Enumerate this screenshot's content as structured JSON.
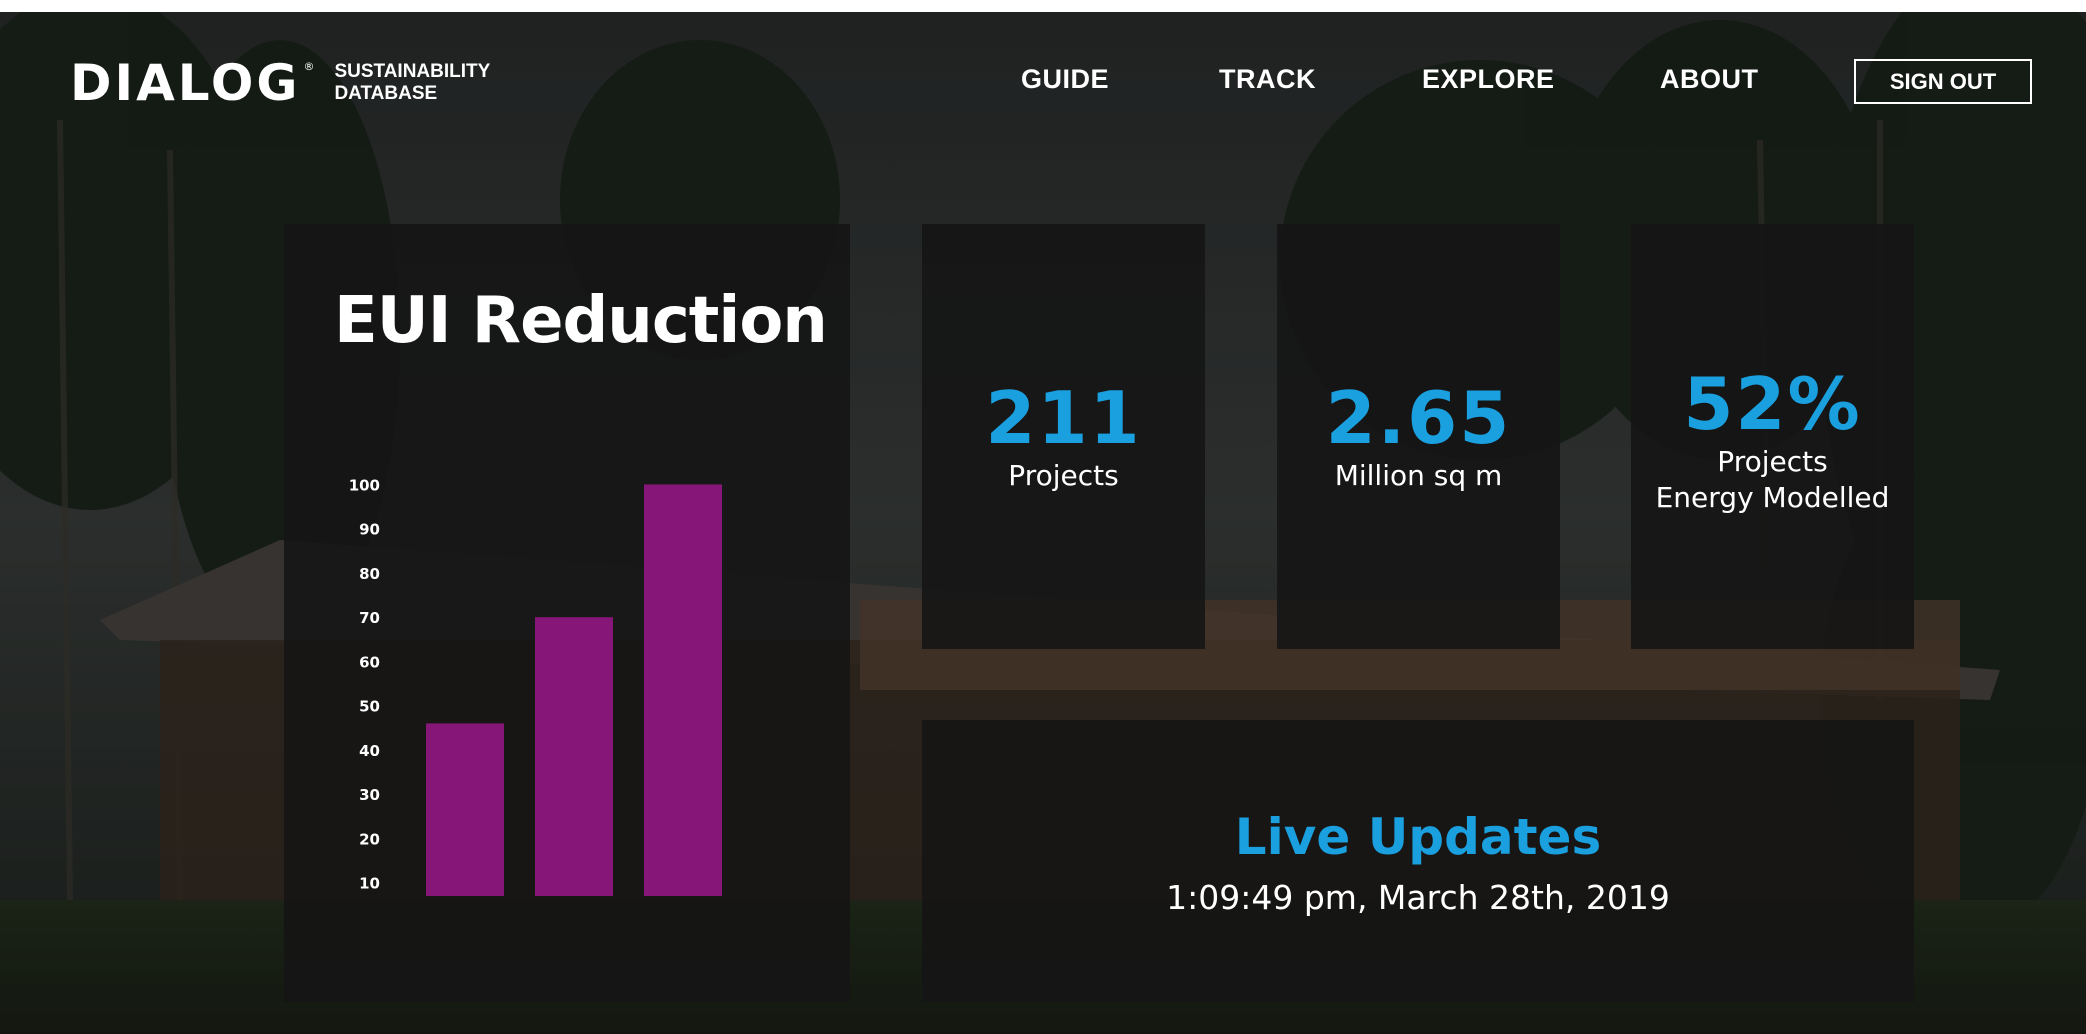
{
  "header": {
    "logo_text": "DIALOG",
    "logo_mark": "®",
    "logo_sub_line1": "SUSTAINABILITY",
    "logo_sub_line2": "DATABASE"
  },
  "nav": {
    "items": [
      {
        "label": "GUIDE"
      },
      {
        "label": "TRACK"
      },
      {
        "label": "EXPLORE"
      },
      {
        "label": "ABOUT"
      }
    ],
    "sign_out_label": "SIGN OUT"
  },
  "stats": {
    "projects": {
      "value": "211",
      "label": "Projects"
    },
    "area": {
      "value": "2.65",
      "label": "Million sq m"
    },
    "modelled": {
      "value": "52%",
      "label_line1": "Projects",
      "label_line2": "Energy Modelled"
    }
  },
  "live": {
    "title": "Live Updates",
    "timestamp": "1:09:49 pm, March 28th, 2019"
  },
  "colors": {
    "accent_blue": "#1a9fdf",
    "bar_purple": "#861678"
  },
  "chart_data": {
    "type": "bar",
    "title": "EUI Reduction",
    "yticks": [
      10,
      20,
      30,
      40,
      50,
      60,
      70,
      80,
      90,
      100
    ],
    "ylim": [
      7,
      101
    ],
    "values": [
      46,
      70,
      100
    ],
    "grid": false
  }
}
